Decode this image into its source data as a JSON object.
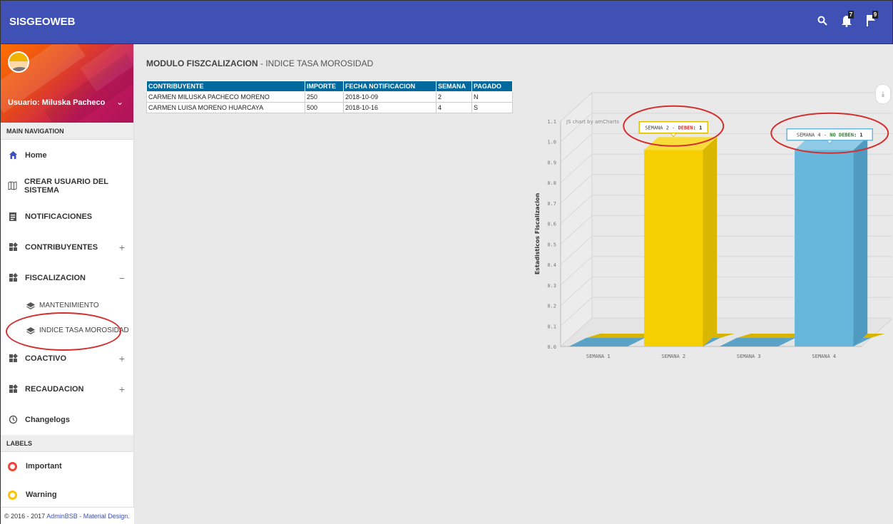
{
  "app": {
    "brand": "SISGEOWEB"
  },
  "topbar": {
    "icons": [
      {
        "name": "search-icon"
      },
      {
        "name": "bell-icon",
        "badge": "7"
      },
      {
        "name": "flag-icon",
        "badge": "9"
      }
    ]
  },
  "user": {
    "label": "Usuario: Miluska Pacheco"
  },
  "sidebar": {
    "main_header": "MAIN NAVIGATION",
    "items": [
      {
        "label": "Home",
        "icon": "home-icon",
        "toggle": ""
      },
      {
        "label": "CREAR USUARIO DEL SISTEMA",
        "icon": "map-icon",
        "toggle": ""
      },
      {
        "label": "NOTIFICACIONES",
        "icon": "assignment-icon",
        "toggle": ""
      },
      {
        "label": "CONTRIBUYENTES",
        "icon": "widgets-icon",
        "toggle": "+"
      },
      {
        "label": "FISCALIZACION",
        "icon": "widgets-icon",
        "toggle": "−"
      }
    ],
    "sub_items": [
      {
        "label": "MANTENIMIENTO",
        "icon": "layers-icon"
      },
      {
        "label": "INDICE TASA MOROSIDAD",
        "icon": "layers-icon"
      }
    ],
    "items2": [
      {
        "label": "COACTIVO",
        "icon": "widgets-icon",
        "toggle": "+"
      },
      {
        "label": "RECAUDACION",
        "icon": "widgets-icon",
        "toggle": "+"
      },
      {
        "label": "Changelogs",
        "icon": "update-icon",
        "toggle": ""
      }
    ],
    "labels_header": "LABELS",
    "labels": [
      {
        "label": "Important",
        "color": "#f44336"
      },
      {
        "label": "Warning",
        "color": "#ffc107"
      }
    ],
    "footer_prefix": "© 2016 - 2017 ",
    "footer_link": "AdminBSB - Material Design."
  },
  "main": {
    "title_bold": "MODULO FISZCALIZACION",
    "title_rest": " - INDICE TASA MOROSIDAD",
    "table": {
      "headers": [
        "CONTRIBUYENTE",
        "IMPORTE",
        "FECHA NOTIFICACION",
        "SEMANA",
        "PAGADO"
      ],
      "rows": [
        [
          "CARMEN MILUSKA PACHECO MORENO",
          "250",
          "2018-10-09",
          "2",
          "N"
        ],
        [
          "CARMEN LUISA MORENO HUARCAYA",
          "500",
          "2018-10-16",
          "4",
          "S"
        ]
      ]
    }
  },
  "chart_data": {
    "type": "bar",
    "credit": "JS chart by amCharts",
    "ylabel": "Estadisticos Fiscalizacion",
    "categories": [
      "SEMANA 1",
      "SEMANA 2",
      "SEMANA 3",
      "SEMANA 4"
    ],
    "series": [
      {
        "values": [
          0,
          0.96,
          0,
          0
        ],
        "color": "#f6cf00"
      },
      {
        "values": [
          0,
          0,
          0,
          0.96
        ],
        "color": "#67b7dc"
      }
    ],
    "ylim": [
      0,
      1.1
    ],
    "yticks": [
      "0.0",
      "0.1",
      "0.2",
      "0.3",
      "0.4",
      "0.5",
      "0.6",
      "0.7",
      "0.8",
      "0.9",
      "1.0",
      "1.1"
    ],
    "balloons": [
      {
        "prefix": "SEMANA 2 - ",
        "key": "DEBEN",
        "value": ": 1",
        "key_color": "#d32f2f",
        "category": 1
      },
      {
        "prefix": "SEMANA 4 - ",
        "key": "NO DEBEN",
        "value": ": 1",
        "key_color": "#2e7d32",
        "category": 3
      }
    ],
    "grid": true,
    "style": "3d"
  }
}
